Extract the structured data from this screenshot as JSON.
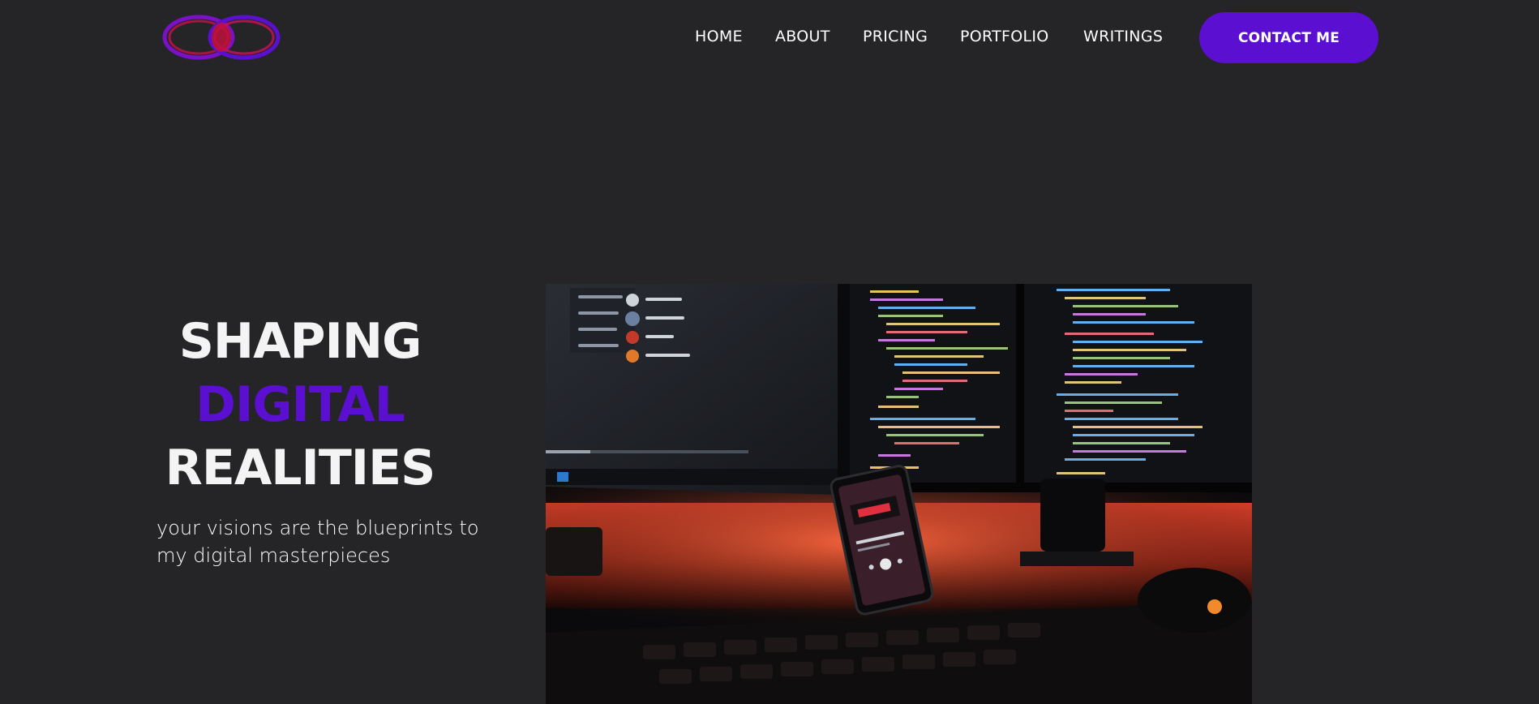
{
  "header": {
    "logo_icon": "interlocking-rings-logo",
    "nav": [
      {
        "label": "HOME"
      },
      {
        "label": "ABOUT"
      },
      {
        "label": "PRICING"
      },
      {
        "label": "PORTFOLIO"
      },
      {
        "label": "WRITINGS"
      }
    ],
    "contact_label": "CONTACT ME"
  },
  "hero": {
    "title_line1": "SHAPING",
    "title_line2": "DIGITAL",
    "title_line3": "REALITIES",
    "subtitle": "your visions are the blueprints to my digital masterpieces",
    "image_icon": "desk-setup-photo"
  },
  "colors": {
    "background": "#252527",
    "accent": "#5b0fd0",
    "text": "#ffffff"
  }
}
